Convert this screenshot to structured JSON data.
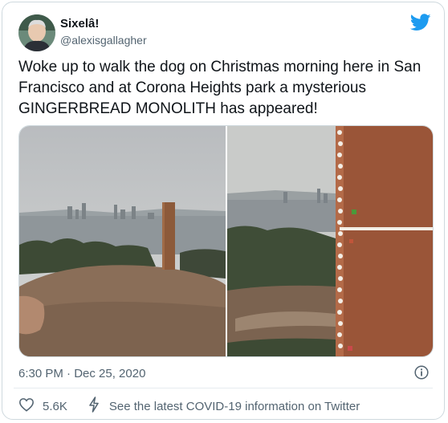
{
  "author": {
    "name": "Sixelâ!",
    "handle": "@alexisgallagher"
  },
  "tweet": {
    "text": "Woke up to walk the dog on Christmas morning here in San Francisco and at Corona Heights park a mysterious GINGERBREAD MONOLITH has appeared!",
    "timestamp": "6:30 PM · Dec 25, 2020"
  },
  "media": {
    "photos": [
      {
        "description_icon": "city-hill-photo"
      },
      {
        "description_icon": "gingerbread-closeup-photo"
      }
    ]
  },
  "actions": {
    "like_count": "5.6K",
    "covid_label": "See the latest COVID-19 information on Twitter"
  },
  "colors": {
    "twitter_blue": "#1d9bf0",
    "text_primary": "#0f1419",
    "text_secondary": "#536471"
  }
}
